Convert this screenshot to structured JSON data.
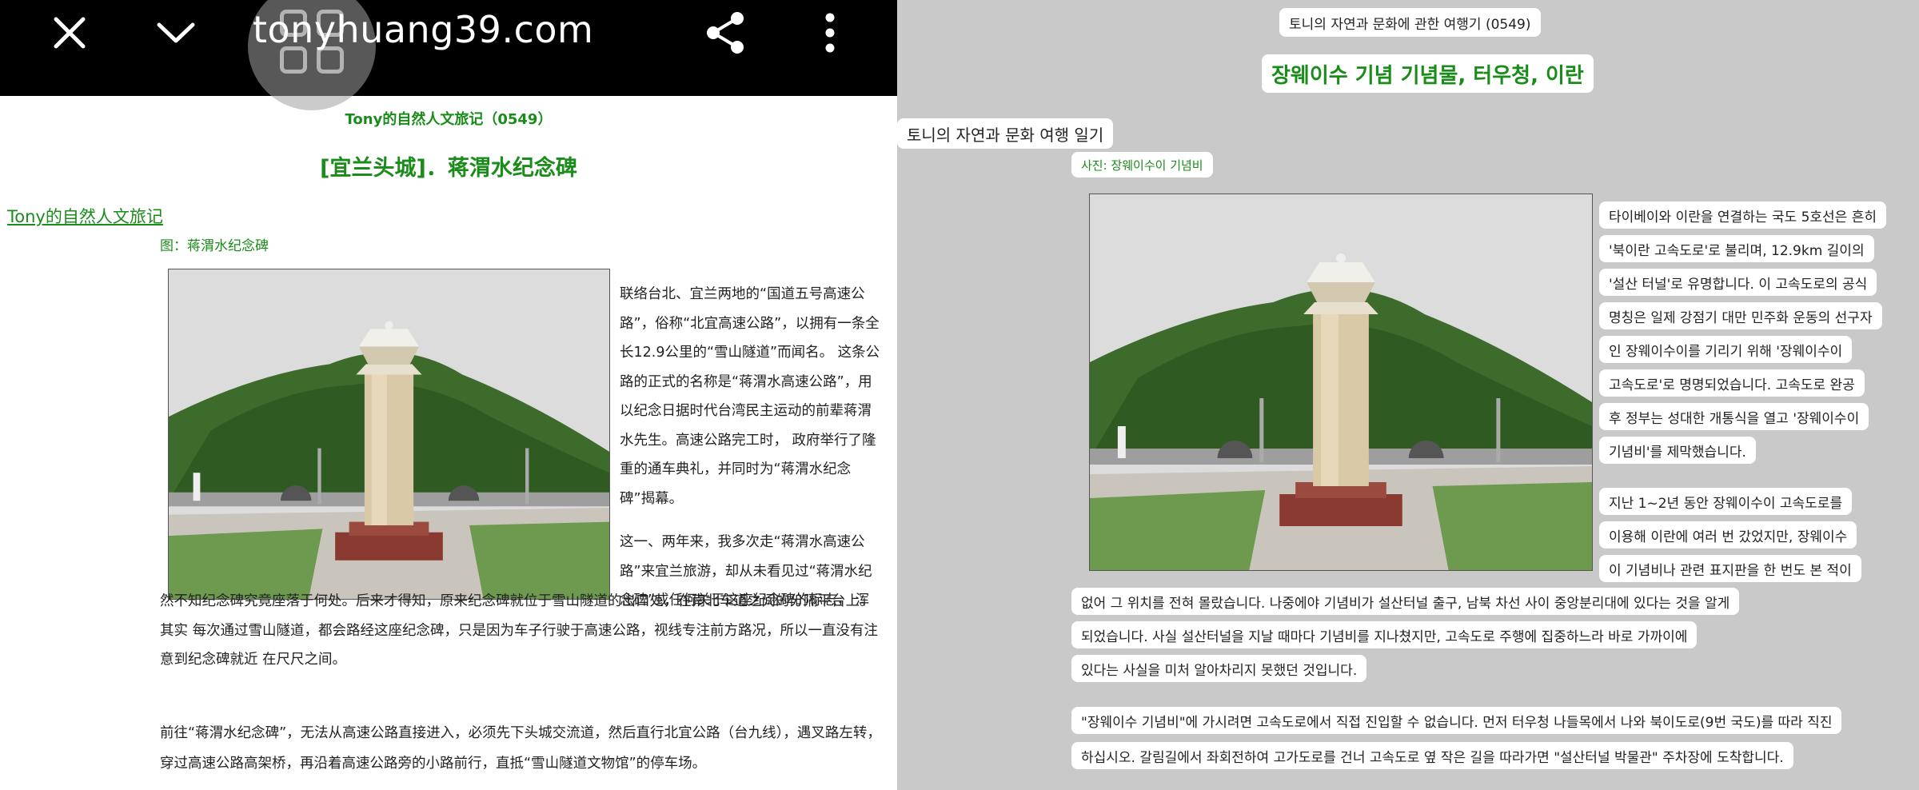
{
  "browser": {
    "url_title": "tonyhuang39.com",
    "close_icon": "close-icon",
    "collapse_icon": "chevron-down-icon",
    "share_icon": "share-icon",
    "menu_icon": "more-vert-icon",
    "tabs_badge_icon": "tabs-grid-icon"
  },
  "original": {
    "subtitle": "Tony的自然人文旅记（0549）",
    "title": "[宜兰头城]．蒋渭水纪念碑",
    "home_link": "Tony的自然人文旅记",
    "caption": "图：蒋渭水纪念碑",
    "para1": "联络台北、宜兰两地的“国道五号高速公路”，俗称“北宜高速公路”，以拥有一条全长12.9公里的“雪山隧道”而闻名。 这条公路的正式的名称是“蒋渭水高速公路”，用以纪念日据时代台湾民主运动的前辈蒋渭水先生。高速公路完工时， 政府举行了隆重的通车典礼，并同时为“蒋渭水纪念碑”揭幕。",
    "para2_top": "这一、两年来，我多次走“蒋渭水高速公路”来宜兰旅游，却从未看见过“蒋渭水纪念碑”或任何关于这座纪念碑的标志， 浑",
    "para2_rest": "然不知纪念碑究竟座落于何处。后来才得知，原来纪念碑就位于雪山隧道的出口处，在南北车道之间的分隔平台上。其实 每次通过雪山隧道，都会路经这座纪念碑，只是因为车子行驶于高速公路，视线专注前方路况，所以一直没有注意到纪念碑就近 在尺尺之间。",
    "para3": "前往“蒋渭水纪念碑”，无法从高速公路直接进入，必须先下头城交流道，然后直行北宜公路（台九线），遇叉路左转， 穿过高速公路高架桥，再沿着高速公路旁的小路前行，直抵“雪山隧道文物馆”的停车场。"
  },
  "translated": {
    "subtitle": "토니의 자연과 문화에 관한 여행기 (0549)",
    "title": "장웨이수 기념 기념물, 터우청, 이란",
    "home_link": "토니의 자연과 문화 여행 일기",
    "caption": "사진: 장웨이수이 기념비",
    "para1_lines": [
      "타이베이와 이란을 연결하는 국도 5호선은 흔히",
      "'북이란 고속도로'로 불리며, 12.9km 길이의",
      "'설산 터널'로 유명합니다. 이 고속도로의 공식",
      "명칭은 일제 강점기 대만 민주화 운동의 선구자",
      "인 장웨이수이를 기리기 위해 '장웨이수이",
      "고속도로'로 명명되었습니다. 고속도로 완공",
      "후 정부는 성대한 개통식을 열고 '장웨이수이",
      "기념비'를 제막했습니다."
    ],
    "para2_side_lines": [
      "지난 1~2년 동안 장웨이수이 고속도로를",
      "이용해 이란에 여러 번 갔었지만, 장웨이수",
      "이 기념비나 관련 표지판을 한 번도 본 적이"
    ],
    "para2_wide_lines": [
      "없어 그 위치를 전혀 몰랐습니다. 나중에야 기념비가 설산터널 출구, 남북 차선 사이 중앙분리대에 있다는 것을 알게",
      "되었습니다. 사실 설산터널을 지날 때마다 기념비를 지나쳤지만, 고속도로 주행에 집중하느라 바로 가까이에",
      "있다는 사실을 미처 알아차리지 못했던 것입니다."
    ],
    "para3_lines": [
      "\"장웨이수 기념비\"에 가시려면 고속도로에서 직접 진입할 수 없습니다. 먼저 터우청 나들목에서 나와 북이도로(9번 국도)를 따라 직진",
      "하십시오. 갈림길에서 좌회전하여 고가도로를 건너 고속도로 옆 작은 길을 따라가면 \"설산터널 박물관\" 주차장에 도착합니다."
    ]
  },
  "colors": {
    "accent_green": "#1a8c1a",
    "toolbar": "#000000",
    "translated_bg": "#c9c9c9"
  }
}
